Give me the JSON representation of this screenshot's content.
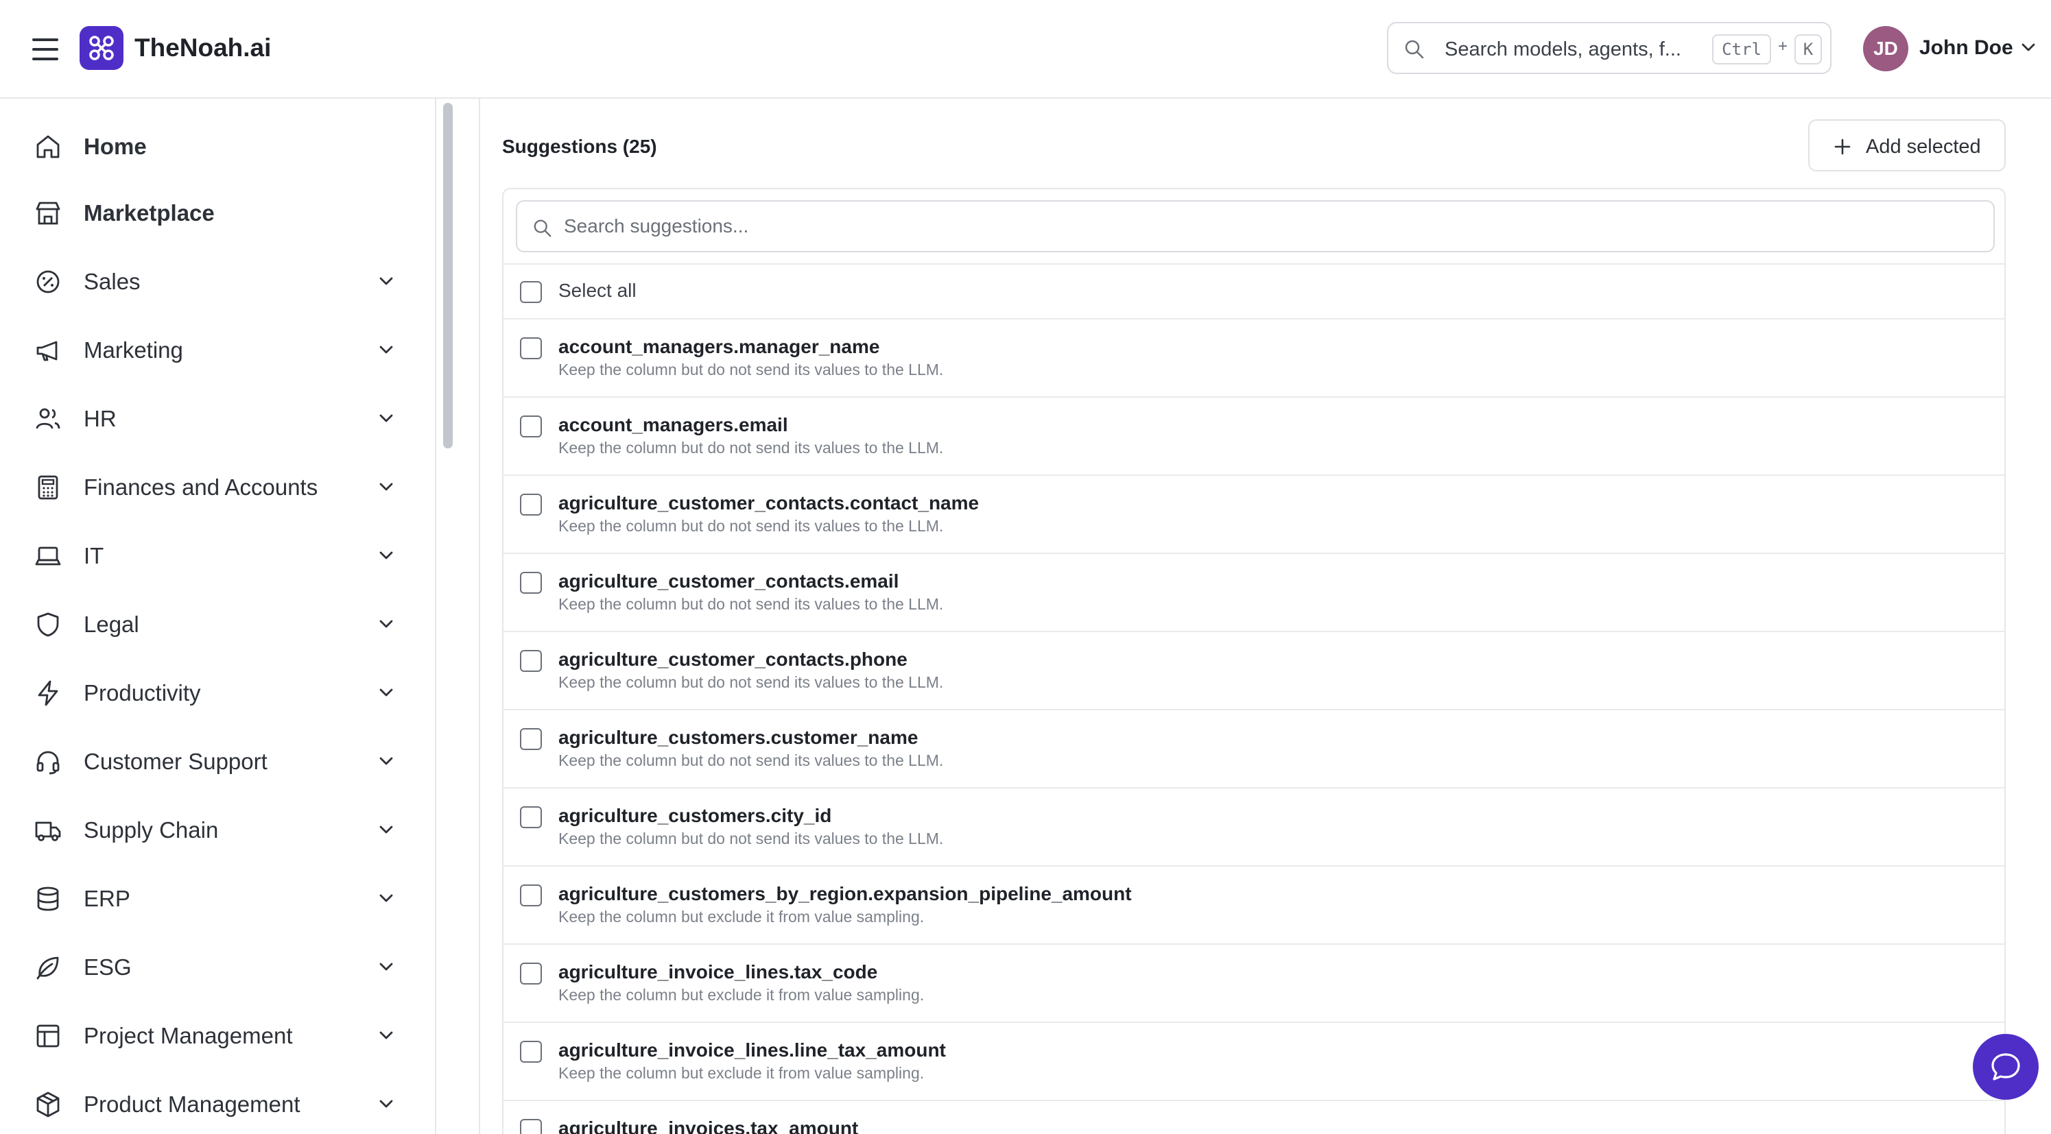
{
  "header": {
    "brand": "TheNoah.ai",
    "search_placeholder": "Search models, agents, f...",
    "shortcut_ctrl": "Ctrl",
    "shortcut_plus": "+",
    "shortcut_key": "K",
    "user_initials": "JD",
    "user_name": "John Doe"
  },
  "colors": {
    "brand": "#4f2ec7",
    "avatar": "#9a5a82"
  },
  "sidebar": {
    "items": [
      {
        "label": "Home",
        "icon": "home-icon",
        "expandable": false
      },
      {
        "label": "Marketplace",
        "icon": "store-icon",
        "expandable": false
      },
      {
        "label": "Sales",
        "icon": "discount-badge-icon",
        "expandable": true
      },
      {
        "label": "Marketing",
        "icon": "megaphone-icon",
        "expandable": true
      },
      {
        "label": "HR",
        "icon": "users-icon",
        "expandable": true
      },
      {
        "label": "Finances and Accounts",
        "icon": "calculator-icon",
        "expandable": true
      },
      {
        "label": "IT",
        "icon": "laptop-icon",
        "expandable": true
      },
      {
        "label": "Legal",
        "icon": "shield-icon",
        "expandable": true
      },
      {
        "label": "Productivity",
        "icon": "lightning-icon",
        "expandable": true
      },
      {
        "label": "Customer Support",
        "icon": "headset-icon",
        "expandable": true
      },
      {
        "label": "Supply Chain",
        "icon": "truck-icon",
        "expandable": true
      },
      {
        "label": "ERP",
        "icon": "database-icon",
        "expandable": true
      },
      {
        "label": "ESG",
        "icon": "leaf-icon",
        "expandable": true
      },
      {
        "label": "Project Management",
        "icon": "layout-icon",
        "expandable": true
      },
      {
        "label": "Product Management",
        "icon": "package-icon",
        "expandable": true
      }
    ]
  },
  "main": {
    "title": "Suggestions (25)",
    "add_selected_label": "Add selected",
    "search_placeholder": "Search suggestions...",
    "select_all_label": "Select all",
    "suggestions": [
      {
        "name": "account_managers.manager_name",
        "desc": "Keep the column but do not send its values to the LLM."
      },
      {
        "name": "account_managers.email",
        "desc": "Keep the column but do not send its values to the LLM."
      },
      {
        "name": "agriculture_customer_contacts.contact_name",
        "desc": "Keep the column but do not send its values to the LLM."
      },
      {
        "name": "agriculture_customer_contacts.email",
        "desc": "Keep the column but do not send its values to the LLM."
      },
      {
        "name": "agriculture_customer_contacts.phone",
        "desc": "Keep the column but do not send its values to the LLM."
      },
      {
        "name": "agriculture_customers.customer_name",
        "desc": "Keep the column but do not send its values to the LLM."
      },
      {
        "name": "agriculture_customers.city_id",
        "desc": "Keep the column but do not send its values to the LLM."
      },
      {
        "name": "agriculture_customers_by_region.expansion_pipeline_amount",
        "desc": "Keep the column but exclude it from value sampling."
      },
      {
        "name": "agriculture_invoice_lines.tax_code",
        "desc": "Keep the column but exclude it from value sampling."
      },
      {
        "name": "agriculture_invoice_lines.line_tax_amount",
        "desc": "Keep the column but exclude it from value sampling."
      },
      {
        "name": "agriculture_invoices.tax_amount",
        "desc": ""
      }
    ]
  }
}
